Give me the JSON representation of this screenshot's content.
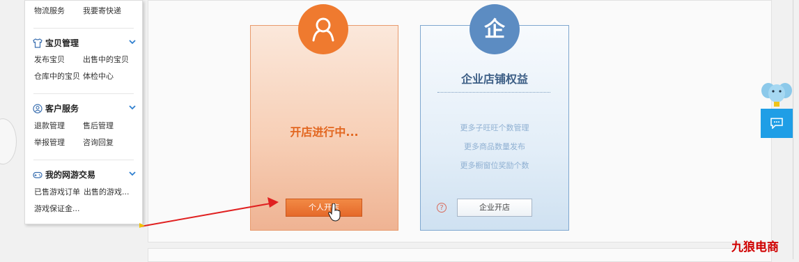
{
  "sidebar": {
    "top_row": [
      "物流服务",
      "我要寄快递"
    ],
    "sections": [
      {
        "title": "宝贝管理",
        "icon": "shirt-icon",
        "rows": [
          [
            "发布宝贝",
            "出售中的宝贝"
          ],
          [
            "仓库中的宝贝",
            "体检中心"
          ]
        ]
      },
      {
        "title": "客户服务",
        "icon": "user-circle-icon",
        "rows": [
          [
            "退款管理",
            "售后管理"
          ],
          [
            "举报管理",
            "咨询回复"
          ]
        ]
      },
      {
        "title": "我的网游交易",
        "icon": "gamepad-icon",
        "rows": [
          [
            "已售游戏订单",
            "出售的游戏..."
          ],
          [
            "游戏保证金...",
            ""
          ]
        ]
      }
    ]
  },
  "personal_card": {
    "status": "开店进行中...",
    "button_label": "个人开店",
    "icon": "person-icon"
  },
  "company_card": {
    "title": "企业店铺权益",
    "benefits": [
      "更多子旺旺个数管理",
      "更多商品数量发布",
      "更多橱窗位奖励个数"
    ],
    "help_glyph": "?",
    "button_label": "企业开店",
    "icon_label": "企"
  },
  "chat_widget": {
    "icon": "chat-bubble-icon"
  },
  "watermark": "九狼电商",
  "colors": {
    "accent_orange": "#ef7a2f",
    "accent_blue": "#5c8cc2",
    "chat_blue": "#1f9ee6",
    "annotation_red": "#e02020"
  }
}
